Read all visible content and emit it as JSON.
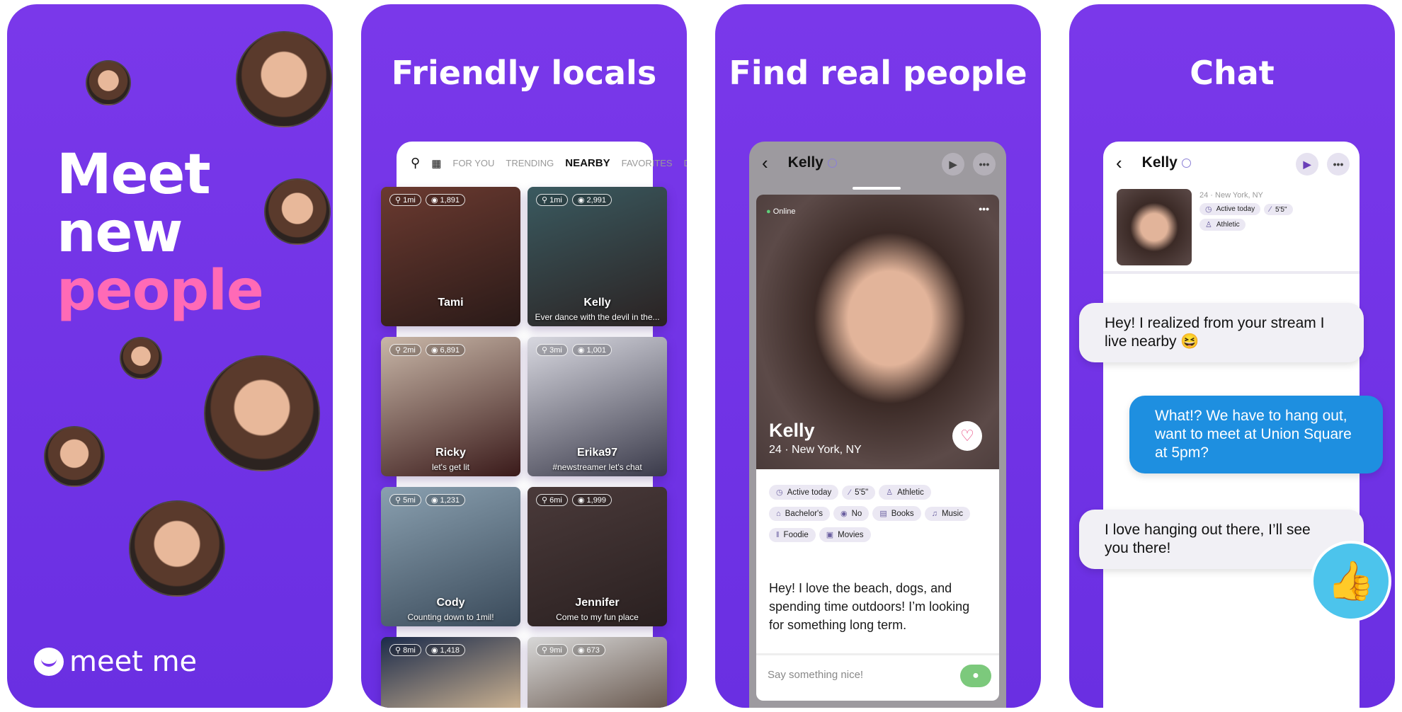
{
  "colors": {
    "purple": "#7a38ea",
    "pink": "#ff6ab6",
    "chat_blue": "#1e8fe0",
    "send_green": "#7cc97c",
    "thumb_blue": "#4cc4ec"
  },
  "panel1": {
    "hero": [
      "Meet",
      "new",
      "people"
    ],
    "logo": "meet me"
  },
  "panel2": {
    "title": "Friendly locals",
    "tabs": [
      "FOR YOU",
      "TRENDING",
      "NEARBY",
      "FAVORITES",
      "DA"
    ],
    "active_tab": "NEARBY",
    "tiles": [
      {
        "dist": "1mi",
        "views": "1,891",
        "name": "Tami",
        "status": ""
      },
      {
        "dist": "1mi",
        "views": "2,991",
        "name": "Kelly",
        "status": "Ever dance with the devil in the..."
      },
      {
        "dist": "2mi",
        "views": "6,891",
        "name": "Ricky",
        "status": "let's get lit"
      },
      {
        "dist": "3mi",
        "views": "1,001",
        "name": "Erika97",
        "status": "#newstreamer let's chat"
      },
      {
        "dist": "5mi",
        "views": "1,231",
        "name": "Cody",
        "status": "Counting down to 1mil!"
      },
      {
        "dist": "6mi",
        "views": "1,999",
        "name": "Jennifer",
        "status": "Come to my fun place"
      },
      {
        "dist": "8mi",
        "views": "1,418",
        "name": "",
        "status": ""
      },
      {
        "dist": "9mi",
        "views": "673",
        "name": "",
        "status": ""
      }
    ]
  },
  "panel3": {
    "title": "Find real people",
    "header_name": "Kelly",
    "online": "Online",
    "name": "Kelly",
    "meta": "24 · New York, NY",
    "chips": [
      [
        "Active today",
        "5'5\"",
        "Athletic"
      ],
      [
        "Bachelor's",
        "No",
        "Books",
        "Music"
      ],
      [
        "Foodie",
        "Movies"
      ]
    ],
    "bio": "Hey! I love the beach, dogs, and spending time outdoors! I’m looking for something long term.",
    "input_placeholder": "Say something nice!"
  },
  "panel4": {
    "title": "Chat",
    "header_name": "Kelly",
    "meta": "24 · New York, NY",
    "chips": [
      "Active today",
      "5'5\"",
      "Athletic"
    ],
    "messages": [
      {
        "from": "them",
        "text": "Hey! I realized from your stream I live nearby 😆"
      },
      {
        "from": "me",
        "text": "What!? We have to hang out, want to meet at Union Square at 5pm?"
      },
      {
        "from": "them",
        "text": "I love hanging out there, I’ll see you there!"
      }
    ]
  }
}
